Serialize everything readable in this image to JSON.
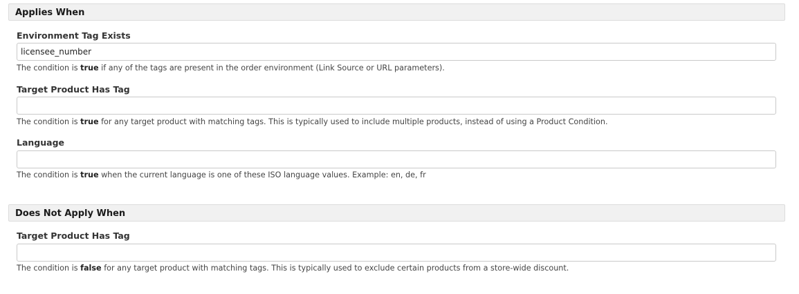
{
  "applies_when": {
    "title": "Applies When",
    "fields": [
      {
        "label": "Environment Tag Exists",
        "value": "licensee_number",
        "help_prefix": "The condition is ",
        "help_keyword": "true",
        "help_suffix": " if any of the tags are present in the order environment (Link Source or URL parameters)."
      },
      {
        "label": "Target Product Has Tag",
        "value": "",
        "help_prefix": "The condition is ",
        "help_keyword": "true",
        "help_suffix": " for any target product with matching tags. This is typically used to include multiple products, instead of using a Product Condition."
      },
      {
        "label": "Language",
        "value": "",
        "help_prefix": "The condition is ",
        "help_keyword": "true",
        "help_suffix": " when the current language is one of these ISO language values. Example: en, de, fr"
      }
    ]
  },
  "does_not_apply_when": {
    "title": "Does Not Apply When",
    "fields": [
      {
        "label": "Target Product Has Tag",
        "value": "",
        "help_prefix": "The condition is ",
        "help_keyword": "false",
        "help_suffix": " for any target product with matching tags. This is typically used to exclude certain products from a store-wide discount."
      }
    ]
  }
}
